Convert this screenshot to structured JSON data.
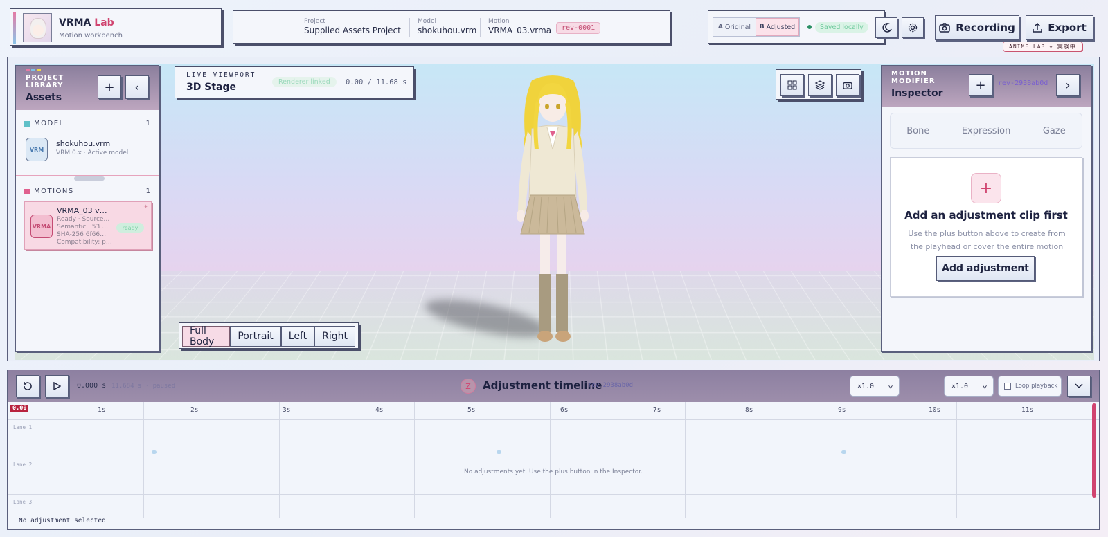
{
  "brand": {
    "title_main": "VRMA",
    "title_accent": "Lab",
    "subtitle": "Motion workbench"
  },
  "project": {
    "project_label": "Project",
    "project_value": "Supplied Assets Project",
    "model_label": "Model",
    "model_value": "shokuhou.vrm",
    "motion_label": "Motion",
    "motion_value": "VRMA_03.vrma",
    "revision": "rev-0001"
  },
  "compare": {
    "a_key": "A",
    "a_label": "Original",
    "b_key": "B",
    "b_label": "Adjusted",
    "saved_status": "Saved locally"
  },
  "toolbar": {
    "recording_label": "Recording",
    "export_label": "Export",
    "tag": "ANIME LAB ✦ 実験中"
  },
  "library": {
    "kicker_1": "PROJECT",
    "kicker_2": "LIBRARY",
    "title": "Assets",
    "add": "+",
    "collapse": "‹",
    "model_section": "MODEL",
    "model_count": "1",
    "model_item": {
      "icon": "VRM",
      "name": "shokuhou.vrm",
      "sub": "VRM 0.x · Active model"
    },
    "motions_section": "MOTIONS",
    "motions_count": "1",
    "motion_item": {
      "icon": "VRMA",
      "name": "VRMA_03 v…",
      "line1": "Ready · Source…",
      "line2": "Semantic · 53 …",
      "line3": "SHA-256 6f66…",
      "line4": "Compatibility: p…",
      "badge": "ready",
      "star": "✦"
    }
  },
  "viewport": {
    "kicker": "LIVE VIEWPORT",
    "title": "3D Stage",
    "linked": "Renderer linked",
    "time": "0.00 / 11.68 s",
    "camera_presets": [
      "Full Body",
      "Portrait",
      "Left",
      "Right"
    ],
    "active_preset": "Full Body"
  },
  "inspector": {
    "kicker_1": "MOTION",
    "kicker_2": "MODIFIER",
    "title": "Inspector",
    "add": "+",
    "rev": "rev-2938ab0d",
    "next": "›",
    "tabs": [
      "Bone",
      "Expression",
      "Gaze"
    ],
    "card_plus": "+",
    "card_title": "Add an adjustment clip first",
    "card_desc": "Use the plus button above to create from the playhead or cover the entire motion",
    "card_button": "Add adjustment"
  },
  "timeline": {
    "time": "0.000 s",
    "time_sub": "11.684 s · paused",
    "title_icon": "Z",
    "title": "Adjustment timeline",
    "rev": "rev-2938ab0d",
    "speed_1": "×1.0",
    "speed_2": "×1.0",
    "loop_label": "Loop playback",
    "playhead": "0.00",
    "ticks": [
      "1s",
      "2s",
      "3s",
      "4s",
      "5s",
      "6s",
      "7s",
      "8s",
      "9s",
      "10s",
      "11s"
    ],
    "lanes": [
      "Lane 1",
      "Lane 2",
      "Lane 3"
    ],
    "empty": "No adjustments yet. Use the plus button in the Inspector.",
    "status": "No adjustment selected"
  },
  "colors": {
    "accent": "#d0436f",
    "panel_head": "#8b7f9d",
    "ready": "#2a8f64"
  }
}
